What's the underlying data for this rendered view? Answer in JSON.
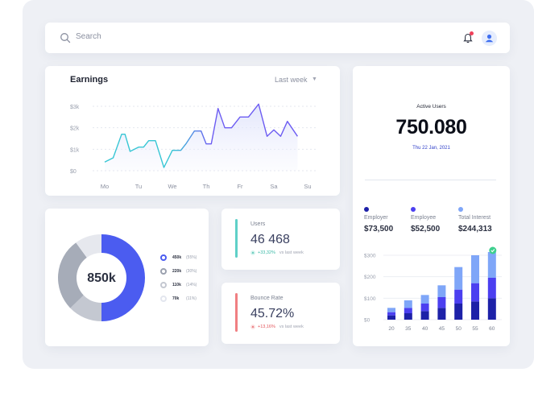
{
  "search": {
    "placeholder": "Search"
  },
  "earnings": {
    "title": "Earnings",
    "period": "Last week"
  },
  "donut": {
    "center_value": "850k",
    "legend": [
      {
        "value": "450k",
        "percent": "(55%)",
        "color": "#4b5cf0"
      },
      {
        "value": "220k",
        "percent": "(30%)",
        "color": "#9aa0ae"
      },
      {
        "value": "110k",
        "percent": "(14%)",
        "color": "#c4c8d1"
      },
      {
        "value": "70k",
        "percent": "(11%)",
        "color": "#e3e6ee"
      }
    ]
  },
  "users_card": {
    "label": "Users",
    "value": "46 468",
    "delta": "+33,32%",
    "note": "vs last week",
    "accent": "#5fd0c8",
    "delta_color": "#3ab9a6"
  },
  "bounce_card": {
    "label": "Bounce Rate",
    "value": "45.72%",
    "delta": "+13,16%",
    "note": "vs last week",
    "accent": "#f07f82",
    "delta_color": "#e2545a"
  },
  "active_users": {
    "label": "Active Users",
    "value": "750.080",
    "date": "Thu 22 Jan, 2021"
  },
  "categories": [
    {
      "label": "Employer",
      "value": "$73,500",
      "color": "#1d21a8"
    },
    {
      "label": "Employee",
      "value": "$52,500",
      "color": "#4b3ff0"
    },
    {
      "label": "Total Interest",
      "value": "$244,313",
      "color": "#7fa6f8"
    }
  ],
  "chart_data": [
    {
      "type": "area",
      "title": "Earnings",
      "categories": [
        "Mo",
        "Tu",
        "We",
        "Th",
        "Fr",
        "Sa",
        "Su"
      ],
      "y_ticks": [
        "$3k",
        "$2k",
        "$1k",
        "$0"
      ],
      "ylim": [
        0,
        3000
      ],
      "x": [
        0,
        0.25,
        0.5,
        0.6,
        0.75,
        1,
        1.15,
        1.3,
        1.5,
        1.75,
        2,
        2.25,
        2.4,
        2.65,
        2.85,
        3,
        3.15,
        3.35,
        3.55,
        3.75,
        4,
        4.25,
        4.55,
        4.8,
        5,
        5.2,
        5.4,
        5.7
      ],
      "values": [
        400,
        600,
        1700,
        1700,
        900,
        1100,
        1100,
        1400,
        1400,
        150,
        950,
        950,
        1250,
        1850,
        1850,
        1250,
        1250,
        2900,
        2000,
        2000,
        2500,
        2500,
        3100,
        1600,
        1900,
        1600,
        2300,
        1600
      ],
      "series_colors": [
        "#37c6d4",
        "#6c5cf2"
      ],
      "grid": true
    },
    {
      "type": "pie",
      "center_label": "850k",
      "slices": [
        {
          "label": "450k",
          "value": 450,
          "percent": 55,
          "color": "#4b5cf0"
        },
        {
          "label": "220k",
          "value": 220,
          "percent": 30,
          "color": "#9aa0ae"
        },
        {
          "label": "110k",
          "value": 110,
          "percent": 14,
          "color": "#c4c8d1"
        },
        {
          "label": "70k",
          "value": 70,
          "percent": 11,
          "color": "#e3e6ee"
        }
      ]
    },
    {
      "type": "bar",
      "stacked": true,
      "categories": [
        "20",
        "35",
        "40",
        "45",
        "50",
        "55",
        "60"
      ],
      "y_ticks": [
        "$300",
        "$200",
        "$100",
        "$0"
      ],
      "ylim": [
        0,
        300
      ],
      "series": [
        {
          "name": "Employer",
          "values": [
            20,
            30,
            40,
            55,
            75,
            85,
            100
          ],
          "color": "#1d21a8"
        },
        {
          "name": "Employee",
          "values": [
            15,
            25,
            35,
            50,
            65,
            85,
            95
          ],
          "color": "#4b3ff0"
        },
        {
          "name": "Total Interest",
          "values": [
            20,
            35,
            40,
            55,
            105,
            130,
            120
          ],
          "color": "#7fa6f8"
        }
      ],
      "grid": true,
      "highlight_badge": "60"
    }
  ]
}
